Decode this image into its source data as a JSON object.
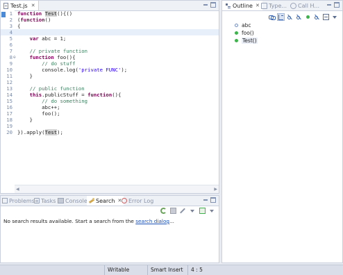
{
  "editor": {
    "tab_label": "Test.js",
    "lines": [
      {
        "n": "1",
        "fold": "",
        "html": "<span class=\"kw\">function</span> <span class=\"occ\">Test</span>(){()"
      },
      {
        "n": "2",
        "fold": "",
        "html": "(<span class=\"kw\">function</span>()"
      },
      {
        "n": "3",
        "fold": "",
        "html": "{"
      },
      {
        "n": "4",
        "fold": "",
        "html": "",
        "current": true
      },
      {
        "n": "5",
        "fold": "",
        "html": "    <span class=\"kw\">var</span> abc = 1;"
      },
      {
        "n": "6",
        "fold": "",
        "html": ""
      },
      {
        "n": "7",
        "fold": "",
        "html": "    <span class=\"cm\">// private function</span>"
      },
      {
        "n": "8",
        "fold": "⊖",
        "html": "    <span class=\"kw\">function</span> foo(){"
      },
      {
        "n": "9",
        "fold": "",
        "html": "        <span class=\"cm\">// do stuff</span>"
      },
      {
        "n": "10",
        "fold": "",
        "html": "        console.log(<span class=\"st\">'private FUNC'</span>);"
      },
      {
        "n": "11",
        "fold": "",
        "html": "    }"
      },
      {
        "n": "12",
        "fold": "",
        "html": ""
      },
      {
        "n": "13",
        "fold": "",
        "html": "    <span class=\"cm\">// public function</span>"
      },
      {
        "n": "14",
        "fold": "",
        "html": "    <span class=\"kw\">this</span>.publicStuff = <span class=\"kw\">function</span>(){"
      },
      {
        "n": "15",
        "fold": "",
        "html": "        <span class=\"cm\">// do something</span>"
      },
      {
        "n": "16",
        "fold": "",
        "html": "        abc++;"
      },
      {
        "n": "17",
        "fold": "",
        "html": "        foo();"
      },
      {
        "n": "18",
        "fold": "",
        "html": "    }"
      },
      {
        "n": "19",
        "fold": "",
        "html": ""
      },
      {
        "n": "20",
        "fold": "",
        "html": "}).apply(<span class=\"occ\">Test</span>);"
      }
    ]
  },
  "outline": {
    "tabs": [
      {
        "label": "Outline",
        "active": true
      },
      {
        "label": "Type...",
        "active": false
      },
      {
        "label": "Call H...",
        "active": false
      }
    ],
    "items": [
      {
        "label": "abc",
        "kind": "var",
        "selected": false
      },
      {
        "label": "foo()",
        "kind": "func",
        "selected": false
      },
      {
        "label": "Test()",
        "kind": "func",
        "selected": true
      }
    ]
  },
  "bottom": {
    "tabs": [
      {
        "label": "Problems",
        "icon": "problems-icon",
        "active": false
      },
      {
        "label": "Tasks",
        "icon": "tasks-icon",
        "active": false
      },
      {
        "label": "Console",
        "icon": "console-icon",
        "active": false
      },
      {
        "label": "Search",
        "icon": "search-tab-icon",
        "active": true
      },
      {
        "label": "Error Log",
        "icon": "errorlog-icon",
        "active": false
      }
    ],
    "message_prefix": "No search results available. Start a search from the ",
    "message_link": "search dialog",
    "message_suffix": "..."
  },
  "status": {
    "mode": "Writable",
    "insert": "Smart Insert",
    "position": "4 : 5"
  },
  "colors": {
    "keyword": "#7f0055",
    "comment": "#3f7f5f",
    "string": "#2a00ff",
    "current_line": "#e6effa",
    "method_green": "#3cb44b"
  }
}
